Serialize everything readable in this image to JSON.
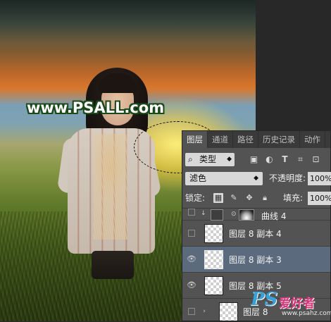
{
  "watermark": {
    "site": "www.PSALL.com",
    "ps_logo": "PS",
    "cn_logo": "爱好者",
    "url": "www.psahz.com"
  },
  "panel": {
    "tabs": [
      "图层",
      "通道",
      "路径",
      "历史记录",
      "动作"
    ],
    "active_tab": "图层",
    "filter": {
      "label": "类型",
      "icons": [
        "image-filter-icon",
        "adjustment-filter-icon",
        "type-filter-icon",
        "shape-filter-icon",
        "smart-object-filter-icon"
      ]
    },
    "blend_mode": "滤色",
    "opacity_label": "不透明度:",
    "opacity_value": "100%",
    "lock_label": "锁定:",
    "fill_label": "填充:",
    "fill_value": "100%",
    "layers": [
      {
        "name": "曲线 4",
        "visible": false,
        "selected": false
      },
      {
        "name": "图层 8 副本 4",
        "visible": false,
        "selected": false
      },
      {
        "name": "图层 8 副本 3",
        "visible": true,
        "selected": true
      },
      {
        "name": "图层 8 副本 5",
        "visible": true,
        "selected": false
      },
      {
        "name": "图层 8",
        "visible": false,
        "selected": false
      }
    ]
  }
}
